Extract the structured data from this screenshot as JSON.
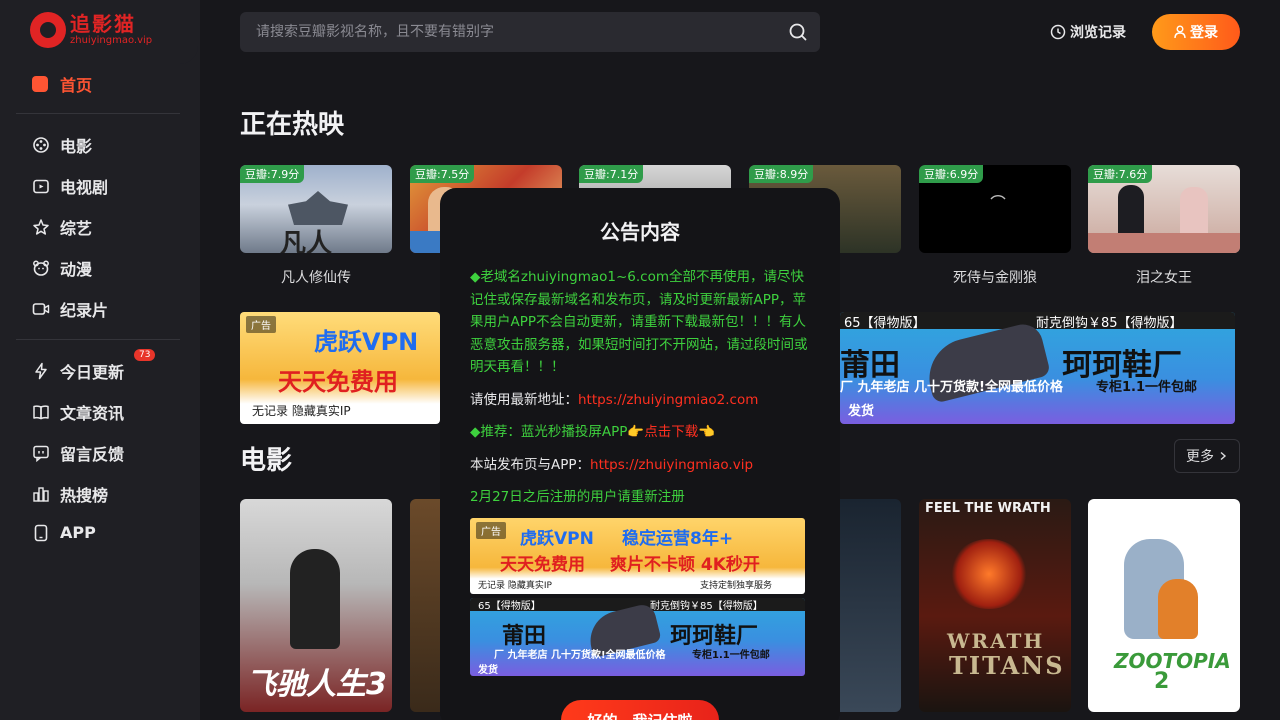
{
  "brand": {
    "name_cn": "追影猫",
    "domain": "zhuiyingmao.vip",
    "accent": "#e02424"
  },
  "sidebar": {
    "home": {
      "label": "首页",
      "icon": "home-icon"
    },
    "group1": [
      {
        "label": "电影",
        "icon": "film-reel-icon"
      },
      {
        "label": "电视剧",
        "icon": "tv-icon"
      },
      {
        "label": "综艺",
        "icon": "star-icon"
      },
      {
        "label": "动漫",
        "icon": "bear-face-icon"
      },
      {
        "label": "纪录片",
        "icon": "video-camera-icon"
      }
    ],
    "group2": [
      {
        "label": "今日更新",
        "icon": "lightning-icon",
        "badge": "73"
      },
      {
        "label": "文章资讯",
        "icon": "book-icon"
      },
      {
        "label": "留言反馈",
        "icon": "message-icon"
      },
      {
        "label": "热搜榜",
        "icon": "bar-chart-icon"
      },
      {
        "label": "APP",
        "icon": "phone-icon"
      }
    ]
  },
  "header": {
    "search_placeholder": "请搜索豆瓣影视名称，且不要有错别字",
    "history_label": "浏览记录",
    "login_label": "登录"
  },
  "now_showing": {
    "title": "正在热映",
    "items": [
      {
        "rating": "豆瓣:7.9分",
        "title": "凡人修仙传"
      },
      {
        "rating": "豆瓣:7.5分",
        "title": ""
      },
      {
        "rating": "豆瓣:7.1分",
        "title": ""
      },
      {
        "rating": "豆瓣:8.9分",
        "title": ""
      },
      {
        "rating": "豆瓣:6.9分",
        "title": "死侍与金刚狼"
      },
      {
        "rating": "豆瓣:7.6分",
        "title": "泪之女王"
      }
    ]
  },
  "ads": {
    "tag": "广告",
    "vpn": {
      "line1": "虎跃VPN",
      "line2": "天天免费用",
      "line3": "无记录 隐藏真实IP",
      "line1b": "稳定运营8年+",
      "line2b": "爽片不卡顿 4K秒开",
      "line3b": "支持定制独享服务"
    },
    "shoe": {
      "top_a": "65【得物版】",
      "top_b": "耐克倒钩￥85【得物版】",
      "brand": "莆田",
      "brand2": "珂珂鞋厂",
      "sub": "厂 九年老店 几十万货款!全网最低价格",
      "sub2": "专柜1.1一件包邮",
      "ship": "发货"
    }
  },
  "movies": {
    "title": "电影",
    "more_label": "更多"
  },
  "modal": {
    "title": "公告内容",
    "para1": "◆老域名zhuiyingmao1~6.com全部不再使用，请尽快记住或保存最新域名和发布页，请及时更新最新APP，苹果用户APP不会自动更新，请重新下载最新包！！！有人恶意攻击服务器，如果短时间打不开网站，请过段时间或明天再看！！！",
    "para2_prefix": "请使用最新地址：",
    "para2_link": "https://zhuiyingmiao2.com",
    "para3_prefix": "◆推荐：蓝光秒播投屏APP👉",
    "para3_link": "点击下载",
    "para3_suffix": "👈",
    "para4_prefix": "本站发布页与APP：",
    "para4_link": "https://zhuiyingmiao.vip",
    "para5": "2月27日之后注册的用户请重新注册",
    "ok_label": "好的，我记住啦"
  }
}
